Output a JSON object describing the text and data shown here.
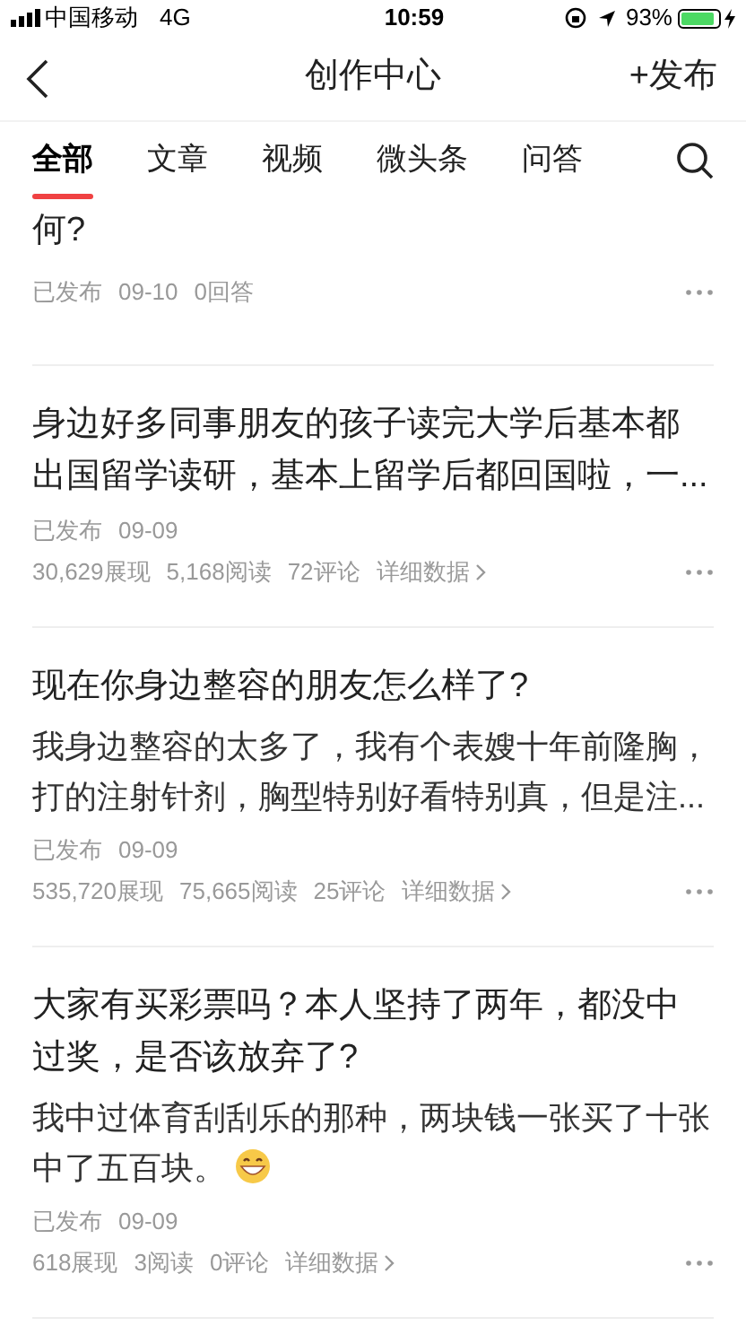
{
  "status_bar": {
    "carrier": "中国移动",
    "network": "4G",
    "time": "10:59",
    "battery": "93%"
  },
  "nav": {
    "title": "创作中心",
    "action": "+发布"
  },
  "tabs": [
    {
      "label": "全部",
      "selected": true
    },
    {
      "label": "文章",
      "selected": false
    },
    {
      "label": "视频",
      "selected": false
    },
    {
      "label": "微头条",
      "selected": false
    },
    {
      "label": "问答",
      "selected": false
    }
  ],
  "articles": [
    {
      "title": "何?",
      "meta": [
        "已发布",
        "09-10",
        "0回答"
      ]
    },
    {
      "title": "身边好多同事朋友的孩子读完大学后基本都出国留学读研，基本上留学后都回国啦，一...",
      "meta": [
        "已发布",
        "09-09"
      ],
      "stats": [
        "30,629展现",
        "5,168阅读",
        "72评论"
      ],
      "detail_link": "详细数据"
    },
    {
      "title": "现在你身边整容的朋友怎么样了?",
      "summary": "我身边整容的太多了，我有个表嫂十年前隆胸，打的注射针剂，胸型特别好看特别真，但是注...",
      "meta": [
        "已发布",
        "09-09"
      ],
      "stats": [
        "535,720展现",
        "75,665阅读",
        "25评论"
      ],
      "detail_link": "详细数据"
    },
    {
      "title": "大家有买彩票吗？本人坚持了两年，都没中过奖，是否该放弃了?",
      "summary": "我中过体育刮刮乐的那种，两块钱一张买了十张中了五百块。",
      "summary_emoji": true,
      "meta": [
        "已发布",
        "09-09"
      ],
      "stats": [
        "618展现",
        "3阅读",
        "0评论"
      ],
      "detail_link": "详细数据"
    }
  ]
}
